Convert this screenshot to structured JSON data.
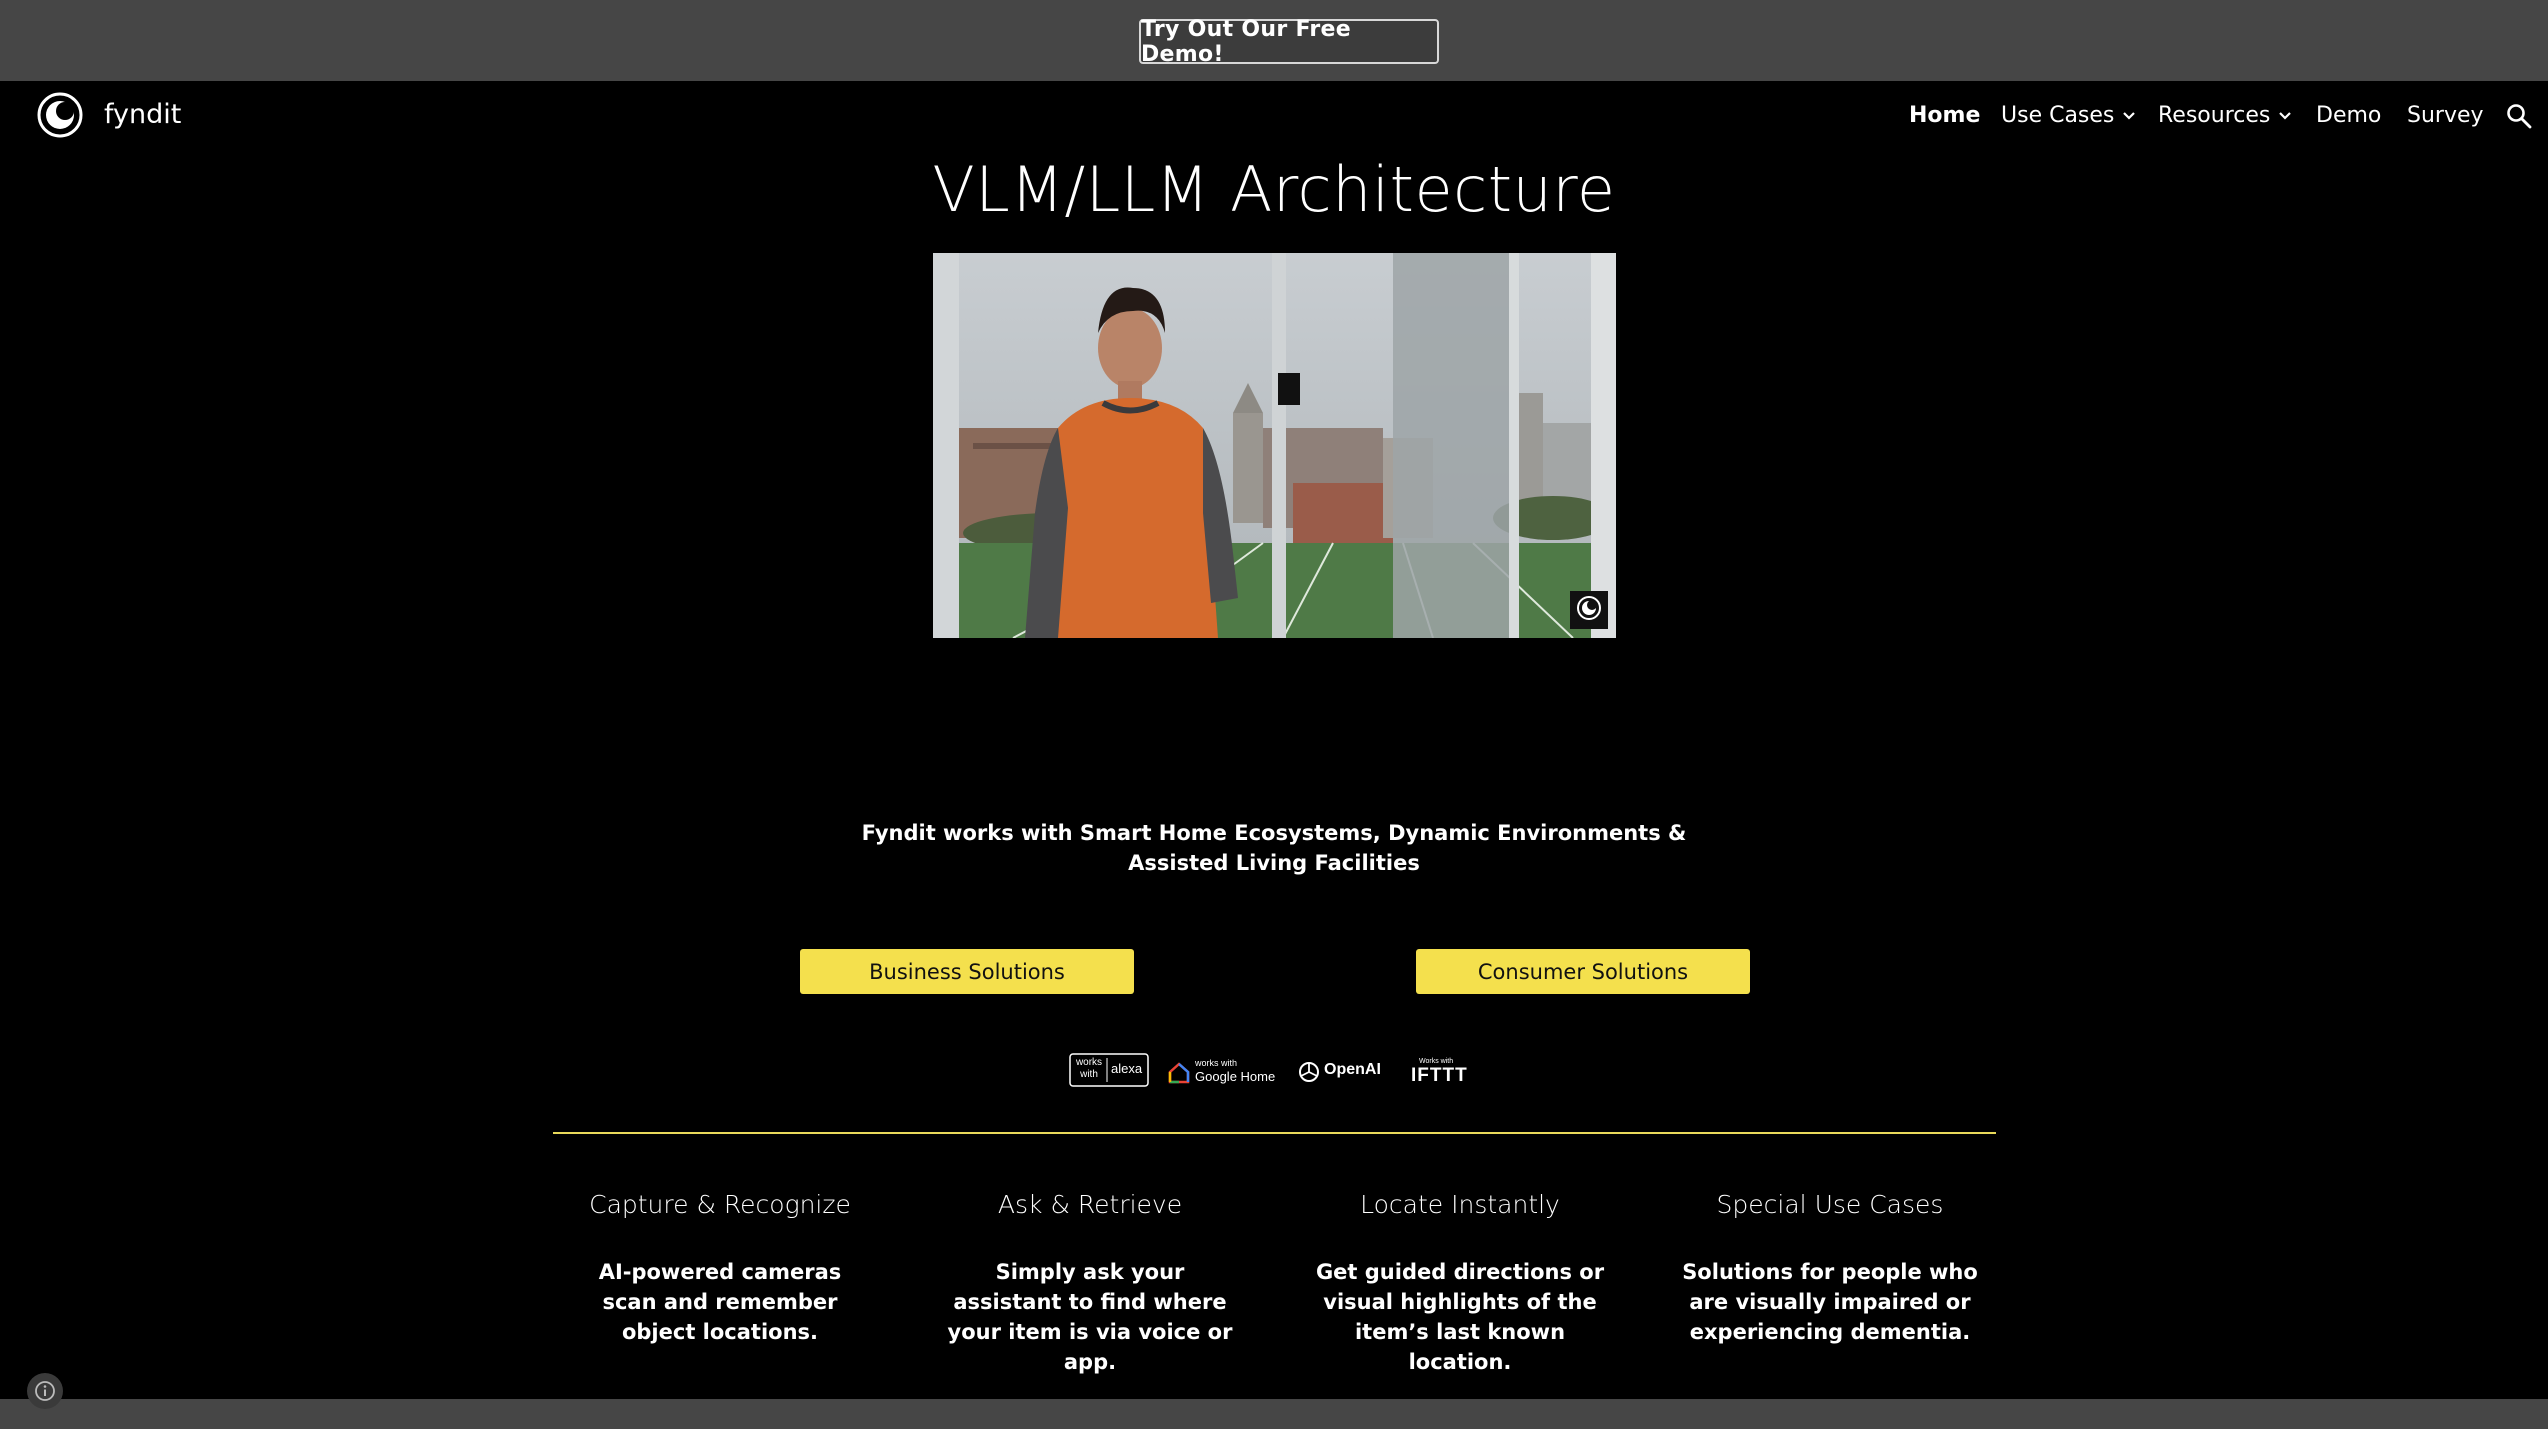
{
  "promo": {
    "button_label": "Try Out Our Free Demo!"
  },
  "brand": {
    "name": "fyndit"
  },
  "nav": {
    "home": "Home",
    "use_cases": "Use Cases",
    "resources": "Resources",
    "demo": "Demo",
    "survey": "Survey"
  },
  "page": {
    "title": "VLM/LLM Architecture"
  },
  "tagline": "Fyndit works with Smart Home Ecosystems, Dynamic Environments & Assisted Living Facilities",
  "solutions": {
    "business": "Business Solutions",
    "consumer": "Consumer Solutions"
  },
  "integrations": {
    "alexa_works": "works",
    "alexa_with": "with",
    "alexa_brand": "alexa",
    "google_small": "works with",
    "google_brand": "Google Home",
    "openai": "OpenAI",
    "ifttt_small": "Works with",
    "ifttt_brand": "IFTTT"
  },
  "features": [
    {
      "title": "Capture & Recognize",
      "body": "AI-powered cameras scan and remember object locations."
    },
    {
      "title": "Ask & Retrieve",
      "body": "Simply ask your assistant to find where your item is via voice or app."
    },
    {
      "title": "Locate Instantly",
      "body": "Get guided directions or visual highlights of the item’s last known location."
    },
    {
      "title": "Special Use Cases",
      "body": "Solutions for people who are visually impaired or experiencing dementia."
    }
  ],
  "colors": {
    "accent": "#f4e04d",
    "divider": "#e8d95a",
    "bar": "#464646"
  }
}
